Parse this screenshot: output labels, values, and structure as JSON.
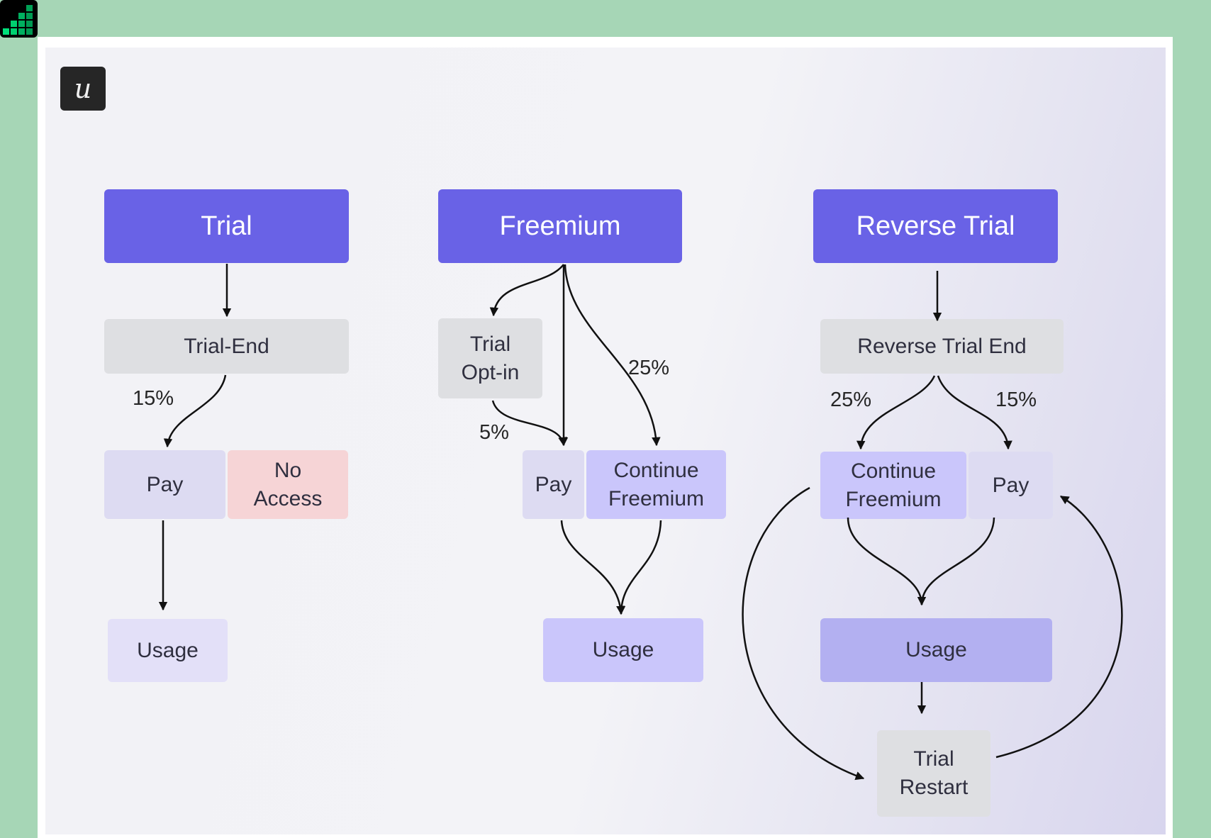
{
  "logo": {
    "glyph": "u",
    "icon": "userpilot-logo-icon"
  },
  "app_icon": {
    "icon": "bar-chart-app-icon",
    "colors": [
      "#00c96b",
      "#00e07a",
      "#009a52"
    ]
  },
  "colors": {
    "header": "#6962e6",
    "gray_node": "#dedfe2",
    "pay_node": "#dddbf2",
    "no_access_node": "#f6d4d6",
    "freemium_node": "#cac6fb",
    "usage_dark": "#b3b0f1",
    "outer_background": "#a6d6b6"
  },
  "columns": [
    {
      "title": "Trial",
      "nodes": {
        "trial_end": "Trial-End",
        "pay": "Pay",
        "no_access": "No Access",
        "usage": "Usage"
      },
      "edges": [
        {
          "from": "Trial",
          "to": "Trial-End",
          "label": ""
        },
        {
          "from": "Trial-End",
          "to": "Pay",
          "label": "15%"
        },
        {
          "from": "Pay",
          "to": "Usage",
          "label": ""
        }
      ]
    },
    {
      "title": "Freemium",
      "nodes": {
        "trial_opt_in": "Trial Opt-in",
        "pay": "Pay",
        "continue_freemium": "Continue Freemium",
        "usage": "Usage"
      },
      "edges": [
        {
          "from": "Freemium",
          "to": "Trial Opt-in",
          "label": ""
        },
        {
          "from": "Freemium",
          "to": "Pay",
          "label": ""
        },
        {
          "from": "Freemium",
          "to": "Continue Freemium",
          "label": "25%"
        },
        {
          "from": "Trial Opt-in",
          "to": "Pay",
          "label": "5%"
        },
        {
          "from": "Pay",
          "to": "Usage",
          "label": ""
        },
        {
          "from": "Continue Freemium",
          "to": "Usage",
          "label": ""
        }
      ]
    },
    {
      "title": "Reverse Trial",
      "nodes": {
        "reverse_trial_end": "Reverse Trial End",
        "continue_freemium": "Continue Freemium",
        "pay": "Pay",
        "usage": "Usage",
        "trial_restart": "Trial Restart"
      },
      "edges": [
        {
          "from": "Reverse Trial",
          "to": "Reverse Trial End",
          "label": ""
        },
        {
          "from": "Reverse Trial End",
          "to": "Continue Freemium",
          "label": "25%"
        },
        {
          "from": "Reverse Trial End",
          "to": "Pay",
          "label": "15%"
        },
        {
          "from": "Continue Freemium",
          "to": "Usage",
          "label": ""
        },
        {
          "from": "Pay",
          "to": "Usage",
          "label": ""
        },
        {
          "from": "Usage",
          "to": "Trial Restart",
          "label": ""
        },
        {
          "from": "Continue Freemium",
          "to": "Trial Restart",
          "label": ""
        },
        {
          "from": "Trial Restart",
          "to": "Pay",
          "label": ""
        }
      ]
    }
  ],
  "labels": {
    "trial_15": "15%",
    "freemium_25": "25%",
    "freemium_5": "5%",
    "reverse_25": "25%",
    "reverse_15": "15%"
  }
}
